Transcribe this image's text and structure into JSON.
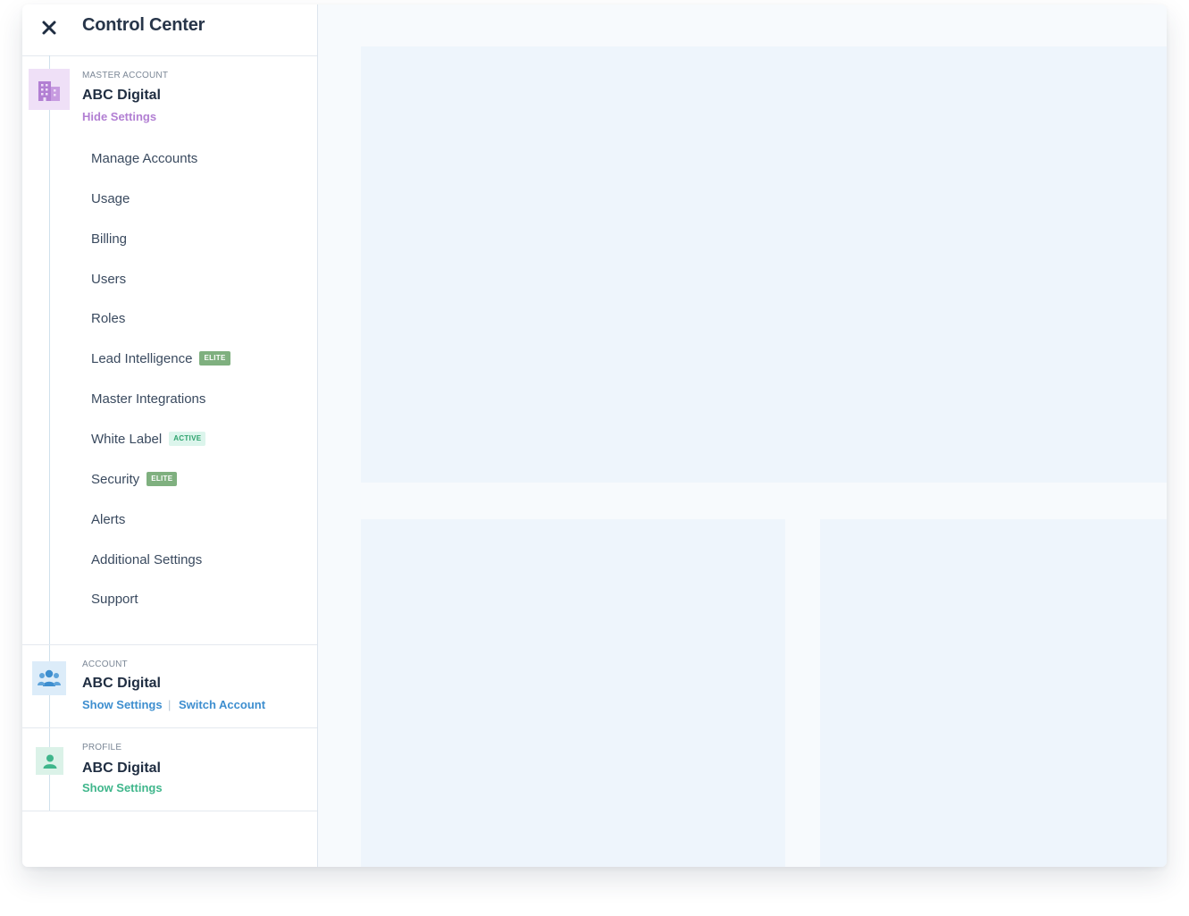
{
  "header": {
    "title": "Control Center",
    "close_icon": "close-icon"
  },
  "master_account": {
    "label": "MASTER ACCOUNT",
    "name": "ABC Digital",
    "link": "Hide Settings",
    "icon": "building-icon",
    "color": "#b27fd3"
  },
  "menu": {
    "items": [
      {
        "label": "Manage Accounts"
      },
      {
        "label": "Usage"
      },
      {
        "label": "Billing"
      },
      {
        "label": "Users"
      },
      {
        "label": "Roles"
      },
      {
        "label": "Lead Intelligence",
        "badge": "ELITE",
        "badge_type": "elite"
      },
      {
        "label": "Master Integrations"
      },
      {
        "label": "White Label",
        "badge": "ACTIVE",
        "badge_type": "active"
      },
      {
        "label": "Security",
        "badge": "ELITE",
        "badge_type": "elite"
      },
      {
        "label": "Alerts"
      },
      {
        "label": "Additional Settings"
      },
      {
        "label": "Support"
      }
    ]
  },
  "account": {
    "label": "ACCOUNT",
    "name": "ABC Digital",
    "show_settings": "Show Settings",
    "separator": "|",
    "switch_account": "Switch Account",
    "icon": "team-icon",
    "color": "#3d8ecf"
  },
  "profile": {
    "label": "PROFILE",
    "name": "ABC Digital",
    "show_settings": "Show Settings",
    "icon": "user-icon",
    "color": "#3fb68b"
  }
}
